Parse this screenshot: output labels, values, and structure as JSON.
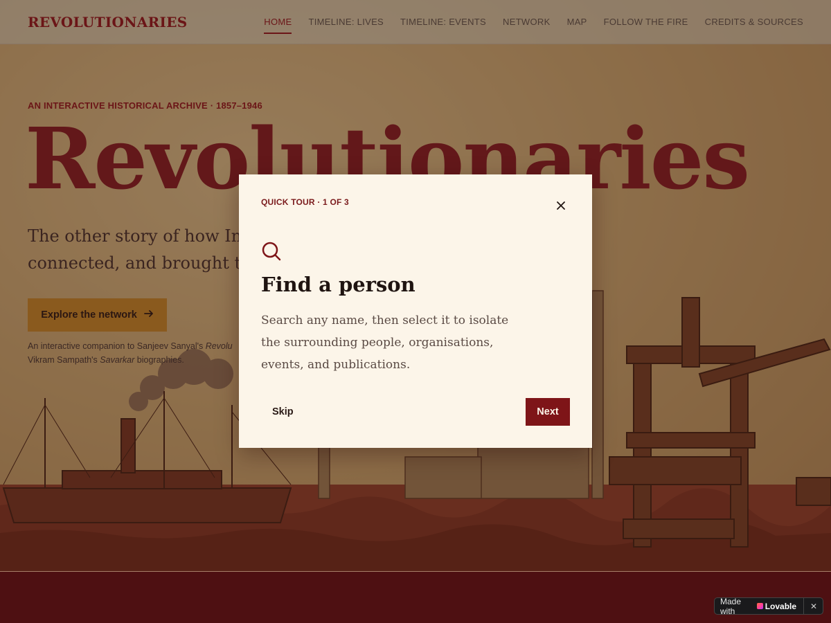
{
  "header": {
    "brand": "REVOLUTIONARIES",
    "nav": [
      {
        "label": "HOME",
        "active": true
      },
      {
        "label": "TIMELINE: LIVES"
      },
      {
        "label": "TIMELINE: EVENTS"
      },
      {
        "label": "NETWORK"
      },
      {
        "label": "MAP"
      },
      {
        "label": "FOLLOW THE FIRE"
      },
      {
        "label": "CREDITS & SOURCES"
      }
    ]
  },
  "hero": {
    "eyebrow": "AN INTERACTIVE HISTORICAL ARCHIVE · 1857–1946",
    "title": "Revolutionaries",
    "subtitle_line1": "The other story of how India",
    "subtitle_line2": "connected, and brought to li",
    "cta_label": "Explore the network",
    "cta_icon": "arrow-right-icon",
    "note_prefix": "An interactive companion to Sanjeev Sanyal's ",
    "note_em1": "Revolu",
    "note_mid": "Vikram Sampath's ",
    "note_em2": "Savarkar",
    "note_suffix": " biographies."
  },
  "modal": {
    "step": "QUICK TOUR · 1 OF 3",
    "icon": "search-icon",
    "title": "Find a person",
    "body": "Search any name, then select it to isolate the surrounding people, organisations, events, and publications.",
    "skip_label": "Skip",
    "next_label": "Next"
  },
  "badge": {
    "prefix": "Made with",
    "brand": "Lovable",
    "close": "✕"
  },
  "colors": {
    "accent": "#7e1518",
    "brand_text": "#6b1517",
    "modal_bg": "#fcf5e9",
    "cta_bg": "#8a5a1e",
    "footer_bg": "#4e1012"
  }
}
